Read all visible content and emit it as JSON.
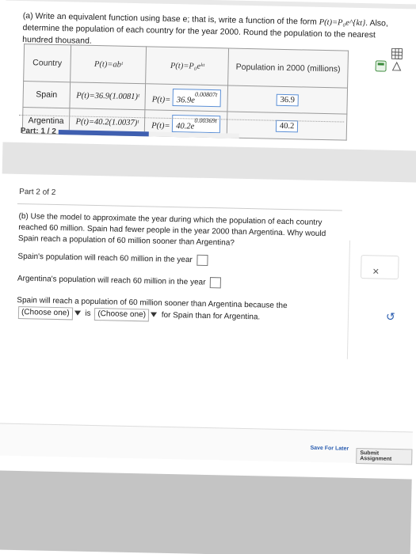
{
  "question_a": {
    "prefix": "(a) Write an equivalent function using base e; that is, write a function of the form",
    "formula_inline": "P(t)=P₀e^{kt}",
    "suffix": ". Also, determine the population of each country for the year 2000. Round the population to the nearest hundred thousand."
  },
  "table": {
    "headers": [
      "Country",
      "P(t)=abᵗ",
      "P(t)=P₀eᵏᵗ",
      "Population in 2000 (millions)"
    ],
    "rows": [
      {
        "country": "Spain",
        "ab_form": "P(t)=36.9(1.0081)ᵗ",
        "e_prefix": "P(t)=",
        "e_base": "36.9e",
        "e_exp": "0.00807t",
        "population": "36.9"
      },
      {
        "country": "Argentina",
        "ab_form": "P(t)=40.2(1.0037)ᵗ",
        "e_prefix": "P(t)=",
        "e_base": "40.2e",
        "e_exp": "0.00369t",
        "population": "40.2"
      }
    ]
  },
  "progress": {
    "label": "Part: 1 / 2",
    "value_percent": 50
  },
  "part2": {
    "label": "Part 2 of 2",
    "question_b": "(b) Use the model to approximate the year during which the population of each country reached 60 million. Spain had fewer people in the year 2000 than Argentina. Why would Spain reach a population of 60 million sooner than Argentina?",
    "spain_line": "Spain's population will reach 60 million in the year",
    "argentina_line": "Argentina's population will reach 60 million in the year",
    "compare_prefix": "Spain will reach a population of 60 million sooner than Argentina because the",
    "choose_one": "(Choose one)",
    "is_text": "is",
    "for_text": "for Spain than for Argentina."
  },
  "tools": {
    "clear_label": "×",
    "undo_label": "↺"
  },
  "footer": {
    "save_label": "Save For Later",
    "submit_label": "Submit Assignment"
  },
  "colors": {
    "accent": "#3f5fb0",
    "link": "#2a5db0"
  }
}
